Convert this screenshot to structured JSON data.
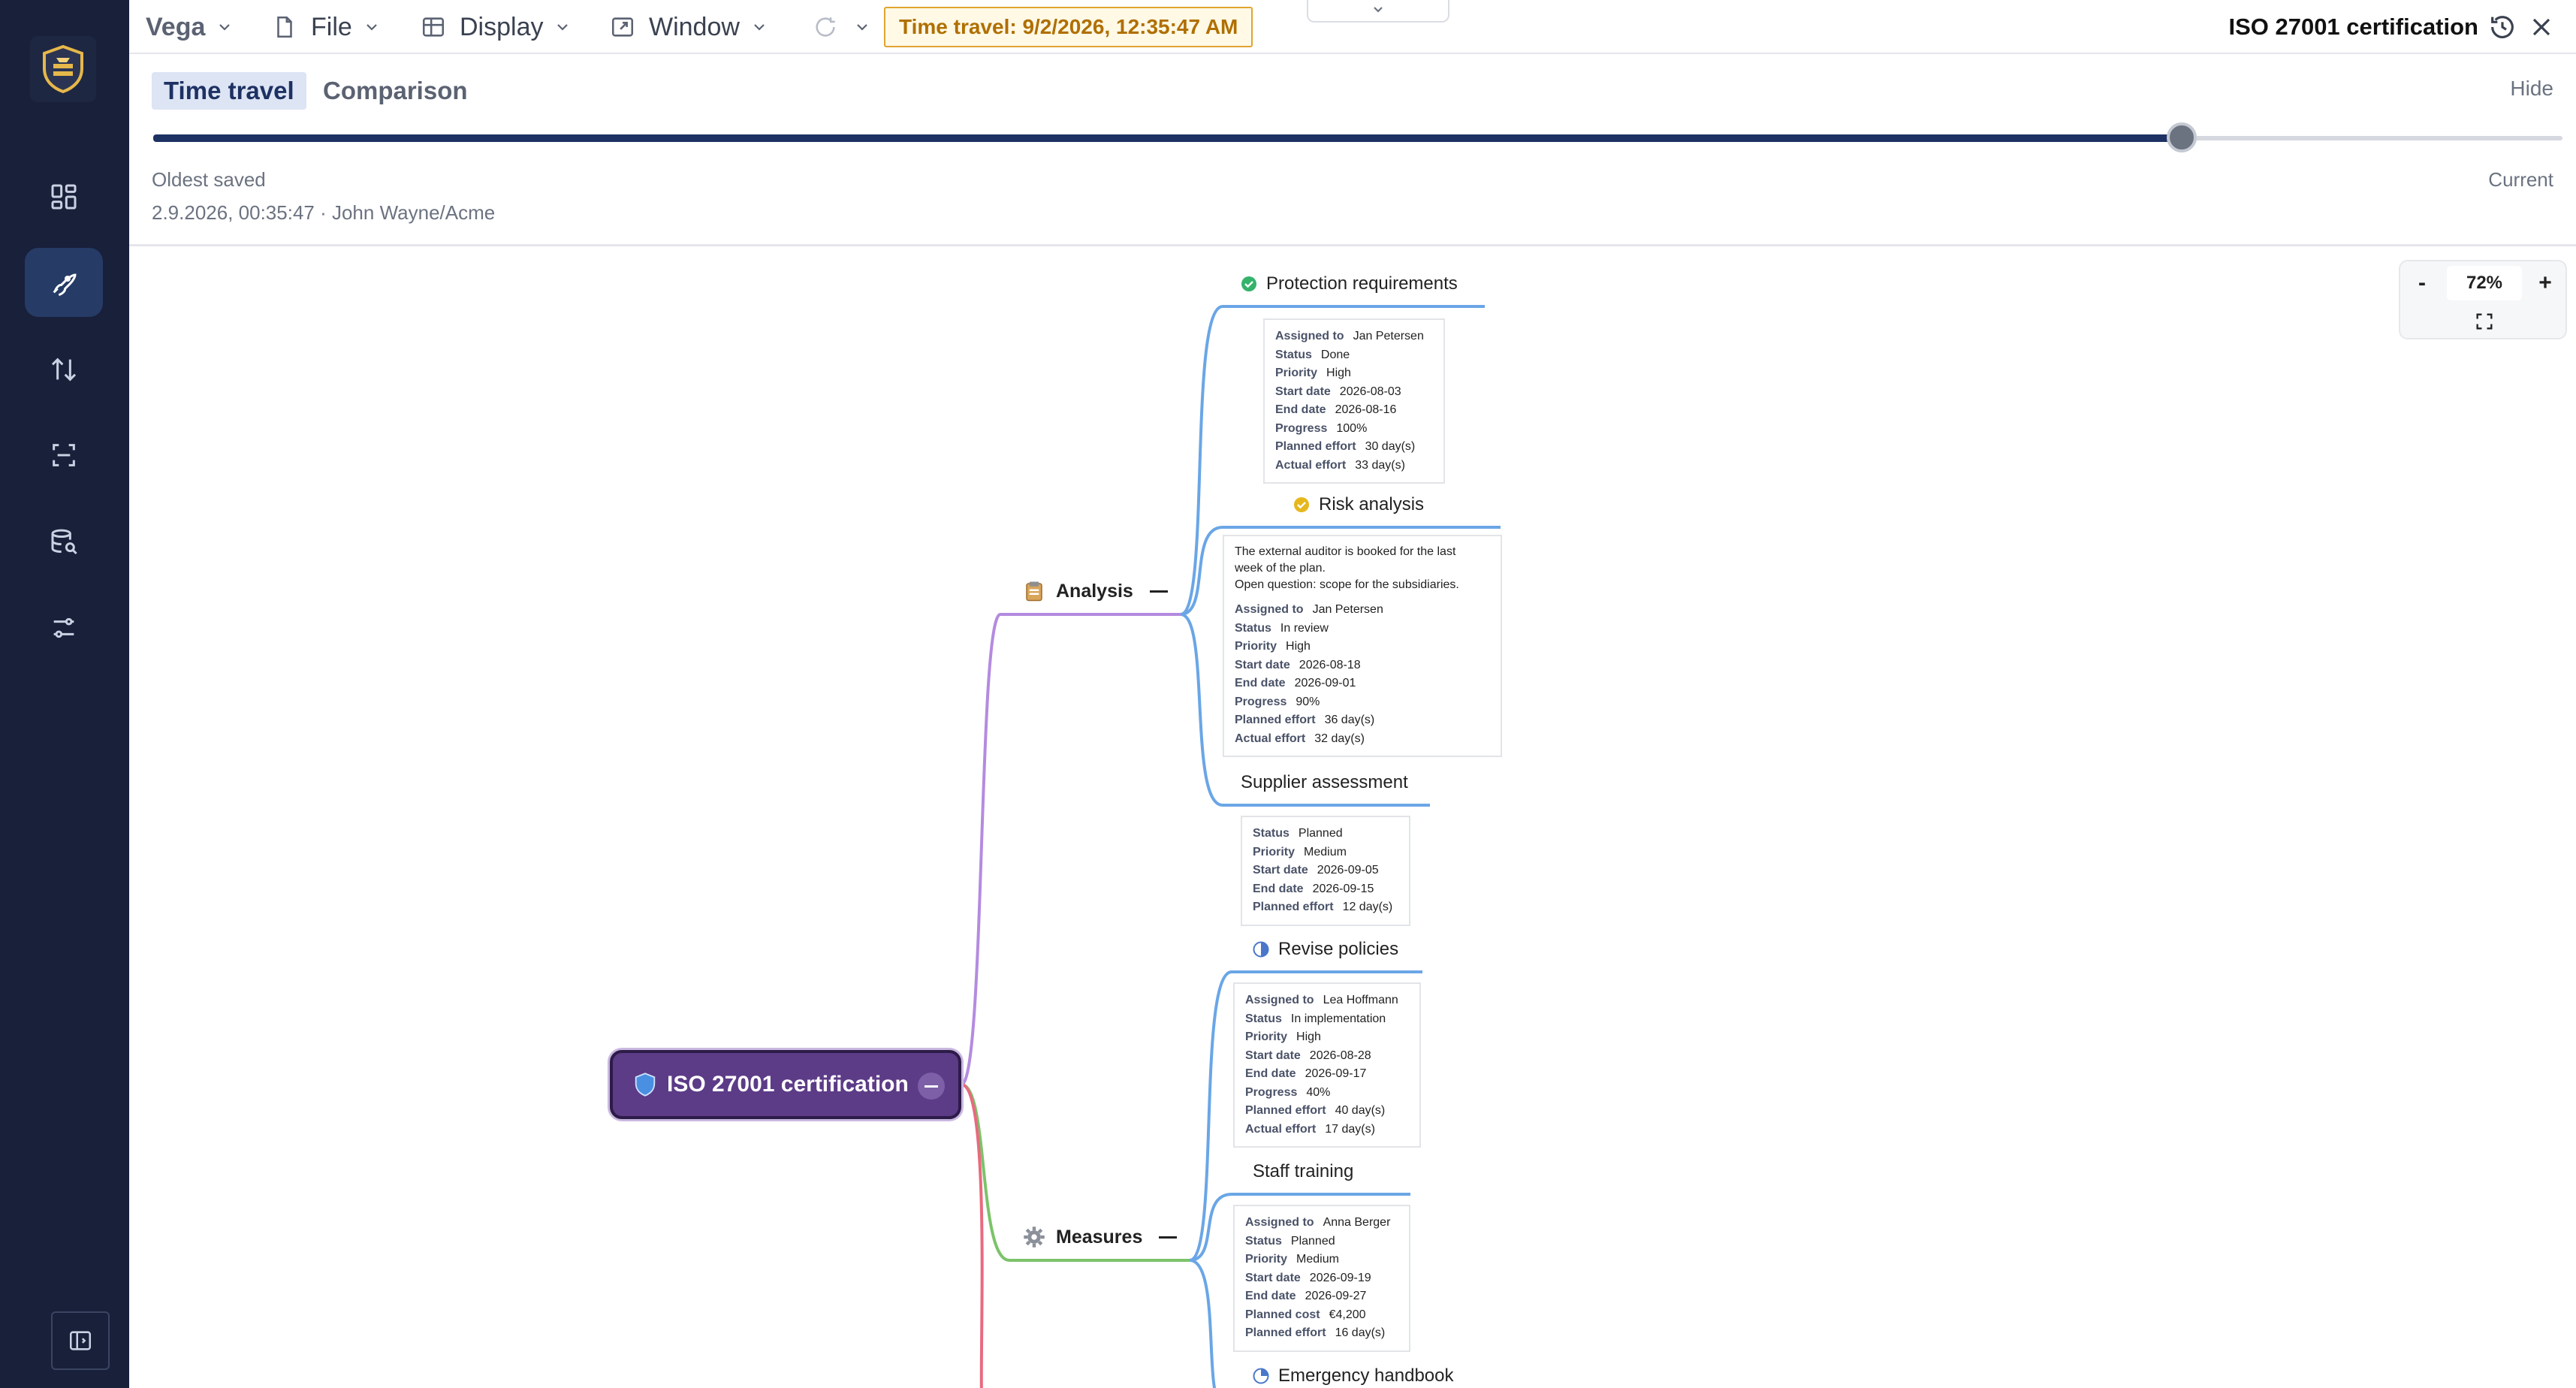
{
  "app": {
    "brand": "Vega",
    "document_title": "ISO 27001 certification"
  },
  "menu": {
    "file": "File",
    "display": "Display",
    "window": "Window"
  },
  "time_travel_badge": "Time travel: 9/2/2026, 12:35:47 AM",
  "panel": {
    "tabs": [
      "Time travel",
      "Comparison"
    ],
    "hide": "Hide",
    "oldest_label": "Oldest saved",
    "current_label": "Current",
    "snapshot_info": "2.9.2026, 00:35:47 · John Wayne/Acme",
    "slider_position": 0.842
  },
  "zoom": {
    "minus": "-",
    "plus": "+",
    "value": "72%"
  },
  "colors": {
    "sidebar": "#18203a",
    "accent": "#1d3163",
    "root": "#5c3b87",
    "analysis_branch": "#b48be0",
    "measures_branch": "#7cc36a",
    "third_branch": "#e86a7f",
    "task_branch": "#6aa6e6",
    "badge": "#e0a431"
  },
  "map": {
    "root": {
      "icon": "shield-icon",
      "label": "ISO 27001 certification"
    },
    "branches": [
      {
        "icon": "clipboard-icon",
        "label": "Analysis"
      },
      {
        "icon": "gear-icon",
        "label": "Measures"
      }
    ],
    "tasks": [
      {
        "icon": "check-circle-green-icon",
        "title": "Protection requirements",
        "fields": [
          [
            "Assigned to",
            "Jan Petersen"
          ],
          [
            "Status",
            "Done"
          ],
          [
            "Priority",
            "High"
          ],
          [
            "Start date",
            "2026-08-03"
          ],
          [
            "End date",
            "2026-08-16"
          ],
          [
            "Progress",
            "100%"
          ],
          [
            "Planned effort",
            "30 day(s)"
          ],
          [
            "Actual effort",
            "33 day(s)"
          ]
        ]
      },
      {
        "icon": "check-circle-yellow-icon",
        "title": "Risk analysis",
        "note": [
          "The external auditor is booked for the last",
          "week of the plan.",
          "Open question: scope for the subsidiaries."
        ],
        "fields": [
          [
            "Assigned to",
            "Jan Petersen"
          ],
          [
            "Status",
            "In review"
          ],
          [
            "Priority",
            "High"
          ],
          [
            "Start date",
            "2026-08-18"
          ],
          [
            "End date",
            "2026-09-01"
          ],
          [
            "Progress",
            "90%"
          ],
          [
            "Planned effort",
            "36 day(s)"
          ],
          [
            "Actual effort",
            "32 day(s)"
          ]
        ]
      },
      {
        "icon": "",
        "title": "Supplier assessment",
        "fields": [
          [
            "Status",
            "Planned"
          ],
          [
            "Priority",
            "Medium"
          ],
          [
            "Start date",
            "2026-09-05"
          ],
          [
            "End date",
            "2026-09-15"
          ],
          [
            "Planned effort",
            "12 day(s)"
          ]
        ]
      },
      {
        "icon": "half-circle-icon",
        "title": "Revise policies",
        "fields": [
          [
            "Assigned to",
            "Lea Hoffmann"
          ],
          [
            "Status",
            "In implementation"
          ],
          [
            "Priority",
            "High"
          ],
          [
            "Start date",
            "2026-08-28"
          ],
          [
            "End date",
            "2026-09-17"
          ],
          [
            "Progress",
            "40%"
          ],
          [
            "Planned effort",
            "40 day(s)"
          ],
          [
            "Actual effort",
            "17 day(s)"
          ]
        ]
      },
      {
        "icon": "",
        "title": "Staff training",
        "fields": [
          [
            "Assigned to",
            "Anna Berger"
          ],
          [
            "Status",
            "Planned"
          ],
          [
            "Priority",
            "Medium"
          ],
          [
            "Start date",
            "2026-09-19"
          ],
          [
            "End date",
            "2026-09-27"
          ],
          [
            "Planned cost",
            "€4,200"
          ],
          [
            "Planned effort",
            "16 day(s)"
          ]
        ]
      },
      {
        "icon": "quarter-circle-icon",
        "title": "Emergency handbook",
        "fields": []
      }
    ]
  }
}
